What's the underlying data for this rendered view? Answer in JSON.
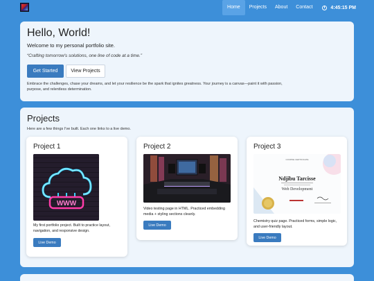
{
  "nav": {
    "links": [
      "Home",
      "Projects",
      "About",
      "Contact"
    ],
    "active": "Home",
    "time": "4:45:15 PM"
  },
  "hero": {
    "title": "Hello, World!",
    "subtitle": "Welcome to my personal portfolio site.",
    "quote": "“Crafting tomorrow's solutions, one line of code at a time.”",
    "primary_button": "Get Started",
    "secondary_button": "View Projects",
    "text": "Embrace the challenges, chase your dreams, and let your resilience be the spark that ignites greatness. Your journey is a canvas—paint it with passion, purpose, and relentless determination."
  },
  "projects": {
    "title": "Projects",
    "subtitle": "Here are a few things I've built. Each one links to a live demo.",
    "items": [
      {
        "title": "Project 1",
        "image": "neon-cloud-www-image",
        "image_text": "WWW",
        "description": "My first portfolio project. Built to practice layout, navigation, and responsive design.",
        "button": "Live Demo"
      },
      {
        "title": "Project 2",
        "image": "recording-studio-image",
        "description": "Video testing page in HTML. Practiced embedding media + styling sections cleanly.",
        "button": "Live Demo"
      },
      {
        "title": "Project 3",
        "image": "certificate-image",
        "image_text": {
          "heading": "COURSE CERTIFICATE",
          "name": "Ndjibu Tarcisse",
          "course": "Web Development"
        },
        "description": "Chemistry quiz page. Practiced forms, simple logic, and user-friendly layout.",
        "button": "Live Demo"
      }
    ]
  },
  "colors": {
    "page_bg": "#3d8fd9",
    "card_bg": "#eef5fc",
    "primary": "#3a7bbf"
  }
}
